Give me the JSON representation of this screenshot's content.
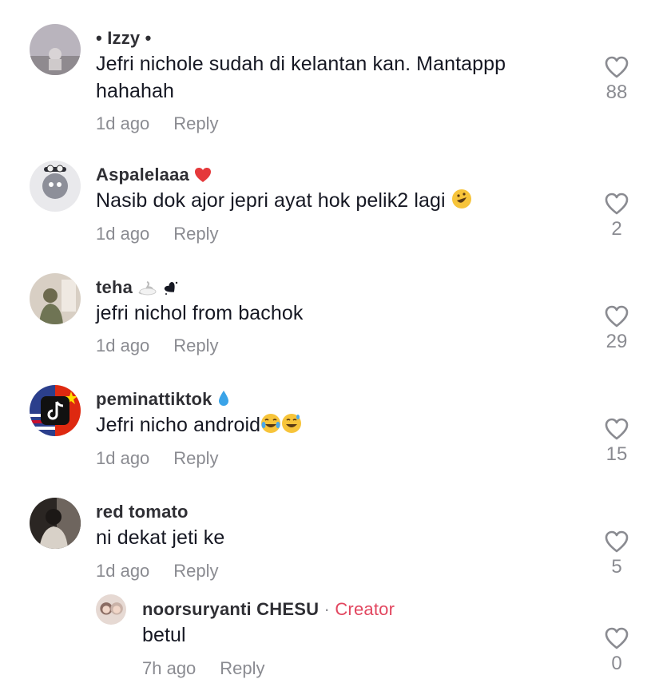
{
  "comments": [
    {
      "username": "• Izzy •",
      "text": "Jefri nichole sudah di kelantan kan. Mantappp hahahah",
      "time": "1d ago",
      "reply": "Reply",
      "likes": "88"
    },
    {
      "username": "Aspalelaaa",
      "text": "Nasib dok ajor jepri ayat hok pelik2 lagi",
      "time": "1d ago",
      "reply": "Reply",
      "likes": "2"
    },
    {
      "username": "teha",
      "text": "jefri nichol from bachok",
      "time": "1d ago",
      "reply": "Reply",
      "likes": "29"
    },
    {
      "username": "peminattiktok",
      "text": "Jefri nicho android",
      "time": "1d ago",
      "reply": "Reply",
      "likes": "15"
    },
    {
      "username": "red tomato",
      "text": "ni dekat jeti ke",
      "time": "1d ago",
      "reply": "Reply",
      "likes": "5"
    }
  ],
  "reply_comment": {
    "username": "noorsuryanti CHESU",
    "separator": " · ",
    "badge": "Creator",
    "text": "betul",
    "time": "7h ago",
    "reply": "Reply",
    "likes": "0"
  },
  "icons": {
    "like": "heart-outline-icon"
  },
  "colors": {
    "creator_badge": "#e2465f",
    "meta_text": "#8a8b91"
  }
}
